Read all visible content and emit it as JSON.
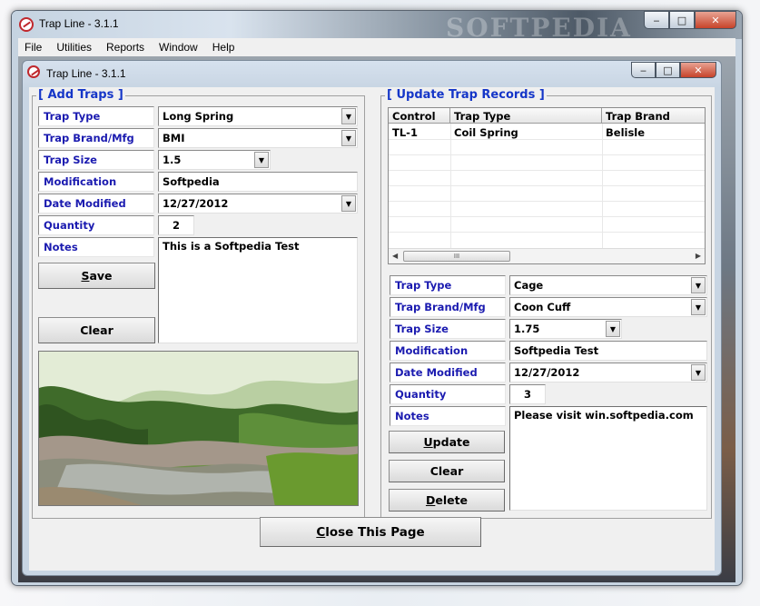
{
  "outer_window": {
    "title": "Trap Line  -  3.1.1",
    "watermark": "SOFTPEDIA"
  },
  "menu": [
    "File",
    "Utilities",
    "Reports",
    "Window",
    "Help"
  ],
  "child_window": {
    "title": "Trap Line - 3.1.1"
  },
  "add_traps": {
    "title": "[ Add Traps ]",
    "trap_type_label": "Trap Type",
    "trap_type_value": "Long Spring",
    "brand_label": "Trap Brand/Mfg",
    "brand_value": "BMI",
    "size_label": "Trap Size",
    "size_value": "1.5",
    "modification_label": "Modification",
    "modification_value": "Softpedia",
    "date_label": "Date Modified",
    "date_value": "12/27/2012",
    "quantity_label": "Quantity",
    "quantity_value": "2",
    "notes_label": "Notes",
    "notes_value": "This is a Softpedia Test",
    "save_mnemonic": "S",
    "save_rest": "ave",
    "clear_label": "Clear"
  },
  "update_records": {
    "title": "[ Update Trap Records ]",
    "grid": {
      "columns": [
        "Control",
        "Trap Type",
        "Trap Brand"
      ],
      "rows": [
        [
          "TL-1",
          "Coil Spring",
          "Belisle"
        ]
      ],
      "scroll_thumb_grip": "III"
    },
    "trap_type_label": "Trap Type",
    "trap_type_value": "Cage",
    "brand_label": "Trap Brand/Mfg",
    "brand_value": "Coon Cuff",
    "size_label": "Trap Size",
    "size_value": "1.75",
    "modification_label": "Modification",
    "modification_value": "Softpedia Test",
    "date_label": "Date Modified",
    "date_value": "12/27/2012",
    "quantity_label": "Quantity",
    "quantity_value": "3",
    "notes_label": "Notes",
    "notes_value": "Please visit win.softpedia.com",
    "update_mnemonic": "U",
    "update_rest": "pdate",
    "clear_label": "Clear",
    "delete_mnemonic": "D",
    "delete_rest": "elete"
  },
  "close_page": {
    "mnemonic": "C",
    "rest": "lose This Page"
  }
}
